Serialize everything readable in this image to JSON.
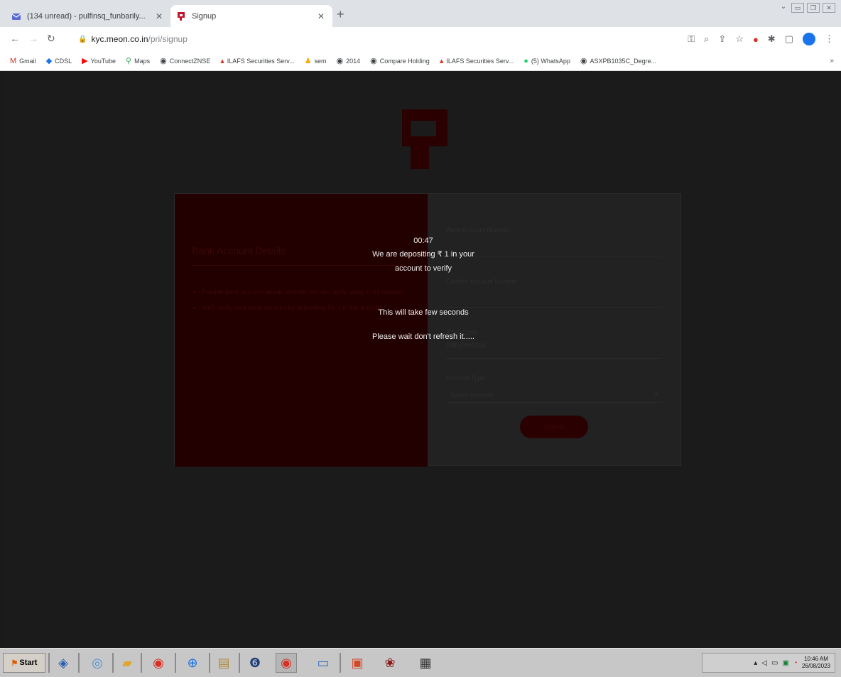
{
  "browser": {
    "tabs": [
      {
        "title": "(134 unread) - pulfinsq_funbarily... ",
        "icon": "gmail-icon"
      },
      {
        "title": "Signup",
        "icon": "meon-logo-icon"
      }
    ],
    "new_tab": "+",
    "url_host": "kyc.meon.co.in",
    "url_path": "/pri/signup",
    "bookmarks": [
      "Gmail",
      "CDSL",
      "YouTube",
      "Maps",
      "ConnectZNSE",
      "ILAFS Securities Serv...",
      "sem",
      "2014",
      "Compare Holding",
      "ILAFS Securities Serv...",
      "(5) WhatsApp",
      "ASXPB1035C_Degre..."
    ],
    "bookmarks_more": "»"
  },
  "page": {
    "card_left": {
      "title": "Bank Account Details",
      "bullets": [
        "Provide bank account details wherein we can verify using a re1 transfer",
        "We'll verify your bank account by depositing Re 1 in the account"
      ]
    },
    "card_right": {
      "labels": [
        "Bank Account Number",
        "Confirm Account Number",
        "IFSC Code",
        "Account Type"
      ],
      "ifsc_value": "SBIN0001234",
      "account_type_placeholder": "Select Account",
      "submit": "Submit"
    }
  },
  "modal": {
    "timer": "00:47",
    "line1": "We are depositing ₹ 1 in your",
    "line2": "account to verify",
    "line3": "This will take few seconds",
    "line4": "Please wait don't refresh it....."
  },
  "taskbar": {
    "start": "Start",
    "clock_time": "10:46 AM",
    "clock_date": "26/08/2023"
  }
}
